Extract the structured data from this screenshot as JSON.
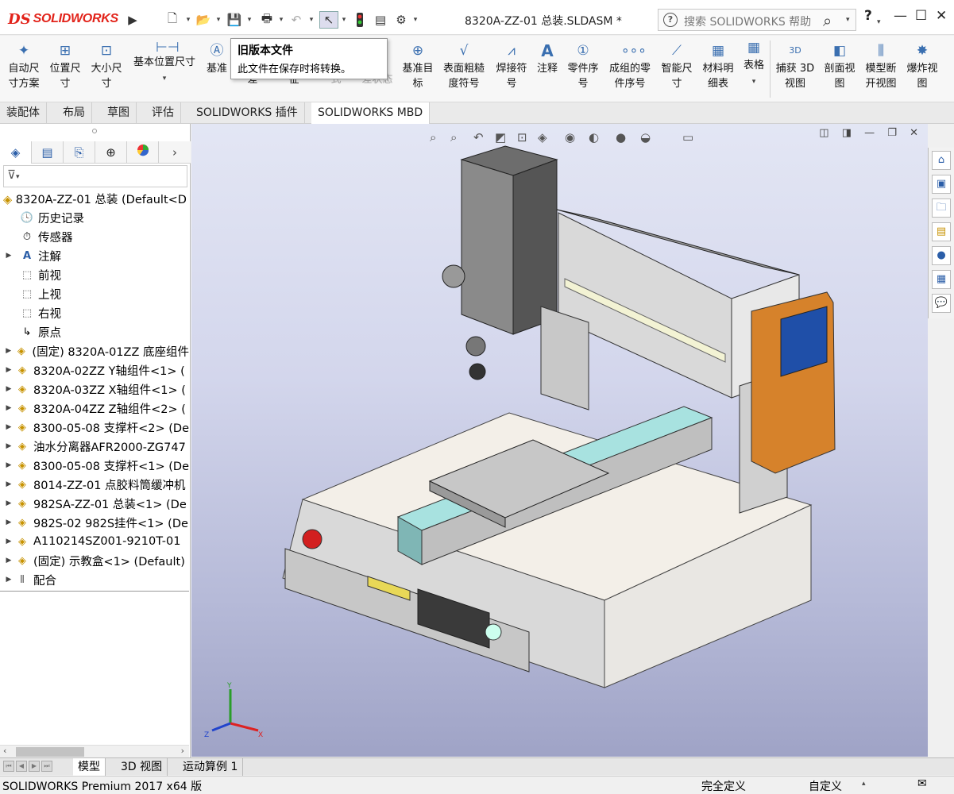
{
  "app": {
    "brand": "SOLIDWORKS",
    "brand_color": "#e2231a"
  },
  "titlebar": {
    "document_title": "8320A-ZZ-01 总装.SLDASM *",
    "search_placeholder": "搜索 SOLIDWORKS 帮助",
    "help": "?",
    "quick_access": [
      "new-icon",
      "open-icon",
      "save-icon",
      "print-icon",
      "undo-icon",
      "select-icon",
      "rebuild-icon",
      "file-properties-icon",
      "options-icon"
    ]
  },
  "ribbon": {
    "items": [
      {
        "label": "自动尺寸方案",
        "line1": "自动尺",
        "line2": "寸方案",
        "icon": "auto-dimension-icon"
      },
      {
        "label": "位置尺寸",
        "line1": "位置尺",
        "line2": "寸",
        "icon": "location-dimension-icon"
      },
      {
        "label": "大小尺寸",
        "line1": "大小尺",
        "line2": "寸",
        "icon": "size-dimension-icon"
      },
      {
        "label": "基本位置尺寸",
        "line1": "基本位置尺寸",
        "line2": "",
        "icon": "basic-location-dimension-icon"
      },
      {
        "label": "基准",
        "line1": "基准",
        "line2": "",
        "icon": "datum-icon"
      },
      {
        "label": "差",
        "line1": "",
        "line2": "差",
        "icon": "tolerance-icon"
      },
      {
        "label": "征",
        "line1": "",
        "line2": "征",
        "icon": "feature-icon"
      },
      {
        "label": "式",
        "line1": "",
        "line2": "式",
        "icon": "pattern-icon"
      },
      {
        "label": "差状态",
        "line1": "公",
        "line2": "差状态",
        "icon": "tolstatus-icon"
      },
      {
        "label": "基准目标",
        "line1": "基准目",
        "line2": "标",
        "icon": "datum-target-icon"
      },
      {
        "label": "表面粗糙度符号",
        "line1": "表面粗糙",
        "line2": "度符号",
        "icon": "surface-finish-icon"
      },
      {
        "label": "焊接符号",
        "line1": "焊接符",
        "line2": "号",
        "icon": "weld-symbol-icon"
      },
      {
        "label": "注释",
        "line1": "注释",
        "line2": "",
        "icon": "note-icon"
      },
      {
        "label": "零件序号",
        "line1": "零件序",
        "line2": "号",
        "icon": "balloon-icon"
      },
      {
        "label": "成组的零件序号",
        "line1": "成组的零",
        "line2": "件序号",
        "icon": "stacked-balloon-icon"
      },
      {
        "label": "智能尺寸",
        "line1": "智能尺",
        "line2": "寸",
        "icon": "smart-dimension-icon"
      },
      {
        "label": "材料明细表",
        "line1": "材料明",
        "line2": "细表",
        "icon": "bom-icon"
      },
      {
        "label": "表格",
        "line1": "表格",
        "line2": "",
        "icon": "table-icon"
      },
      {
        "label": "捕获 3D 视图",
        "line1": "捕获 3D",
        "line2": "视图",
        "icon": "capture-3d-view-icon"
      },
      {
        "label": "剖面视图",
        "line1": "剖面视",
        "line2": "图",
        "icon": "section-view-icon"
      },
      {
        "label": "模型断开视图",
        "line1": "模型断",
        "line2": "开视图",
        "icon": "model-break-view-icon"
      },
      {
        "label": "爆炸视图",
        "line1": "爆炸视",
        "line2": "图",
        "icon": "explode-view-icon"
      }
    ]
  },
  "tooltip": {
    "title": "旧版本文件",
    "text": "此文件在保存时将转换。"
  },
  "command_tabs": [
    "装配体",
    "布局",
    "草图",
    "评估",
    "SOLIDWORKS 插件",
    "SOLIDWORKS MBD"
  ],
  "feature_tree": {
    "root": "8320A-ZZ-01 总装  (Default<D",
    "items": [
      {
        "label": "历史记录",
        "icon": "history-icon",
        "expand": false
      },
      {
        "label": "传感器",
        "icon": "sensor-icon",
        "expand": false
      },
      {
        "label": "注解",
        "icon": "annotations-icon",
        "expand": true
      },
      {
        "label": "前视",
        "icon": "plane-icon",
        "expand": false
      },
      {
        "label": "上视",
        "icon": "plane-icon",
        "expand": false
      },
      {
        "label": "右视",
        "icon": "plane-icon",
        "expand": false
      },
      {
        "label": "原点",
        "icon": "origin-icon",
        "expand": false
      },
      {
        "label": "(固定) 8320A-01ZZ 底座组件",
        "icon": "component-icon",
        "expand": true
      },
      {
        "label": "8320A-02ZZ Y轴组件<1> (",
        "icon": "component-icon",
        "expand": true
      },
      {
        "label": "8320A-03ZZ X轴组件<1> (",
        "icon": "component-icon",
        "expand": true
      },
      {
        "label": "8320A-04ZZ Z轴组件<2> (",
        "icon": "component-icon",
        "expand": true
      },
      {
        "label": "8300-05-08 支撑杆<2> (De",
        "icon": "component-icon",
        "expand": true
      },
      {
        "label": "油水分离器AFR2000-ZG747",
        "icon": "component-icon",
        "expand": true
      },
      {
        "label": "8300-05-08 支撑杆<1> (De",
        "icon": "component-icon",
        "expand": true
      },
      {
        "label": "8014-ZZ-01 点胶料筒缓冲机",
        "icon": "component-icon",
        "expand": true
      },
      {
        "label": "982SA-ZZ-01 总装<1> (De",
        "icon": "component-icon",
        "expand": true
      },
      {
        "label": "982S-02 982S挂件<1> (De",
        "icon": "component-icon",
        "expand": true
      },
      {
        "label": "A110214SZ001-9210T-01",
        "icon": "component-icon",
        "expand": true
      },
      {
        "label": "(固定) 示教盒<1> (Default)",
        "icon": "component-icon",
        "expand": true
      },
      {
        "label": "配合",
        "icon": "mates-icon",
        "expand": true
      }
    ]
  },
  "bottom_tabs": [
    "模型",
    "3D 视图",
    "运动算例 1"
  ],
  "status": {
    "product": "SOLIDWORKS Premium 2017 x64 版",
    "state": "完全定义",
    "units": "自定义"
  }
}
